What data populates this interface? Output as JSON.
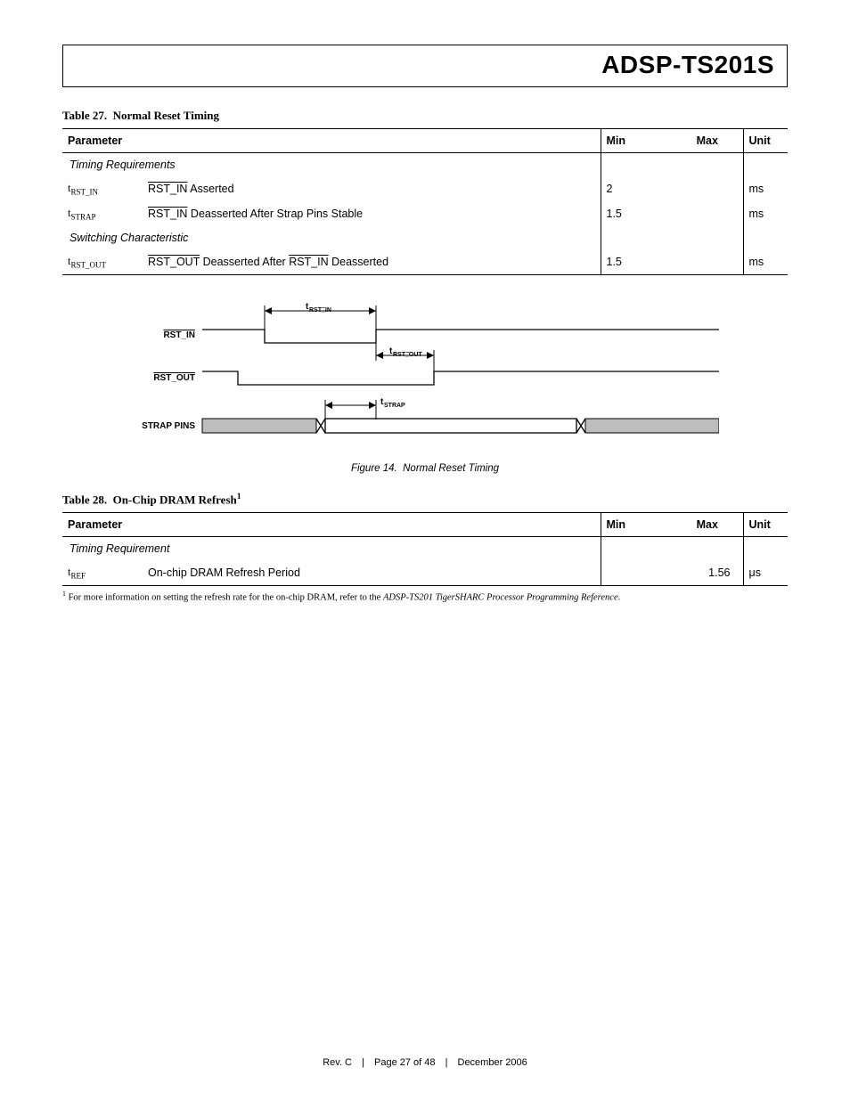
{
  "header": {
    "part_number": "ADSP-TS201S"
  },
  "table27": {
    "caption_prefix": "Table 27.",
    "caption_title": "Normal Reset Timing",
    "col_parameter": "Parameter",
    "col_min": "Min",
    "col_max": "Max",
    "col_unit": "Unit",
    "section_timing_req": "Timing Requirements",
    "rows_timing": [
      {
        "sym_sub": "RST_IN",
        "desc_pre": "RST_IN",
        "desc_post": " Asserted",
        "min": "2",
        "max": "",
        "unit": "ms"
      },
      {
        "sym_sub": "STRAP",
        "desc_pre": "RST_IN",
        "desc_post": " Deasserted After Strap Pins Stable",
        "min": "1.5",
        "max": "",
        "unit": "ms"
      }
    ],
    "section_switching": "Switching Characteristic",
    "rows_switching": [
      {
        "sym_sub": "RST_OUT",
        "desc_pre1": "RST_OUT",
        "desc_mid": " Deasserted After ",
        "desc_pre2": "RST_IN",
        "desc_post": " Deasserted",
        "min": "1.5",
        "max": "",
        "unit": "ms"
      }
    ]
  },
  "figure14": {
    "caption_prefix": "Figure 14.",
    "caption_title": "Normal Reset Timing",
    "signals": {
      "rst_in": "RST_IN",
      "rst_out": "RST_OUT",
      "strap_pins": "STRAP PINS"
    },
    "params": {
      "t_rst_in": "RST_IN",
      "t_rst_out": "RST_OUT",
      "t_strap": "STRAP"
    }
  },
  "table28": {
    "caption_prefix": "Table 28.",
    "caption_title": "On-Chip DRAM Refresh",
    "caption_sup": "1",
    "col_parameter": "Parameter",
    "col_min": "Min",
    "col_max": "Max",
    "col_unit": "Unit",
    "section_timing_req": "Timing Requirement",
    "rows": [
      {
        "sym_sub": "REF",
        "desc": "On-chip DRAM Refresh Period",
        "min": "",
        "max": "1.56",
        "unit": "μs"
      }
    ],
    "footnote_num": "1",
    "footnote_text_pre": " For more information on setting the refresh rate for the on-chip DRAM, refer to the ",
    "footnote_text_ital": "ADSP-TS201 TigerSHARC Processor Programming Reference",
    "footnote_text_post": "."
  },
  "footer": {
    "rev": "Rev. C",
    "page": "Page 27 of 48",
    "date": "December 2006"
  }
}
